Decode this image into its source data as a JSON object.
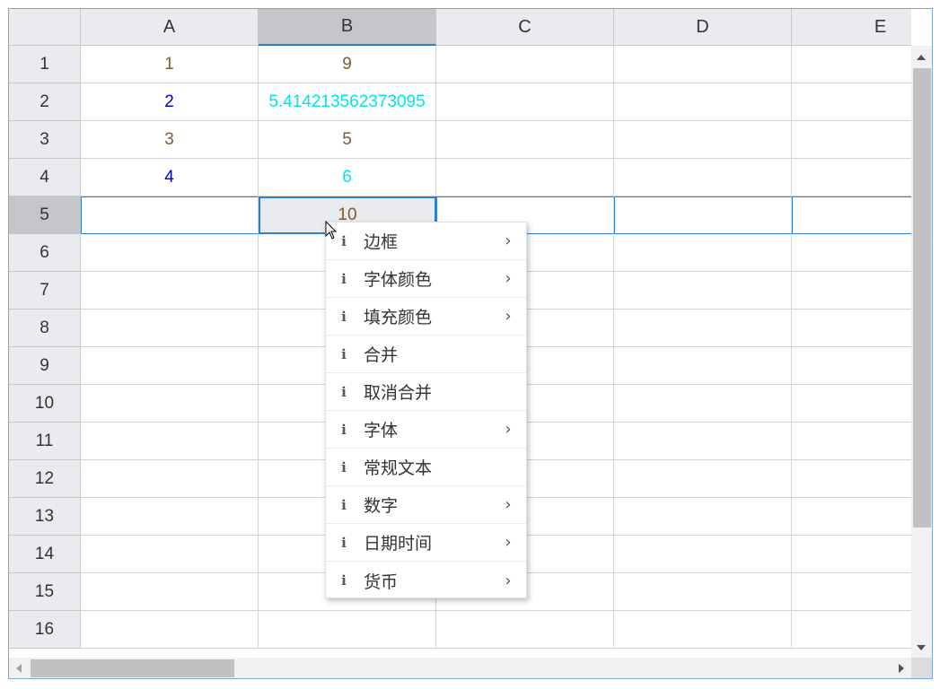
{
  "columns": [
    "A",
    "B",
    "C",
    "D",
    "E"
  ],
  "selected_column": "B",
  "rows": [
    "1",
    "2",
    "3",
    "4",
    "5",
    "6",
    "7",
    "8",
    "9",
    "10",
    "11",
    "12",
    "13",
    "14",
    "15",
    "16"
  ],
  "selected_row": "5",
  "colors": {
    "brown": "#7a5c2e",
    "blue": "#0000cc",
    "cyan": "#00e5e5",
    "selection": "#2e7fd4"
  },
  "cells": [
    {
      "ref": "A1",
      "value": "1",
      "color": "#7a5c2e"
    },
    {
      "ref": "B1",
      "value": "9",
      "color": "#7a5c2e"
    },
    {
      "ref": "A2",
      "value": "2",
      "color": "#0000cc"
    },
    {
      "ref": "B2",
      "value": "5.414213562373095",
      "color": "#00e5e5"
    },
    {
      "ref": "A3",
      "value": "3",
      "color": "#7a5c2e"
    },
    {
      "ref": "B3",
      "value": "5",
      "color": "#7a5c2e"
    },
    {
      "ref": "A4",
      "value": "4",
      "color": "#0000cc"
    },
    {
      "ref": "B4",
      "value": "6",
      "color": "#00e5e5"
    },
    {
      "ref": "B5",
      "value": "10",
      "color": "#7a5c2e"
    }
  ],
  "active_cell": "B5",
  "context_menu": {
    "items": [
      {
        "label": "边框",
        "icon": "info-icon",
        "submenu": true
      },
      {
        "label": "字体颜色",
        "icon": "info-icon",
        "submenu": true
      },
      {
        "label": "填充颜色",
        "icon": "info-icon",
        "submenu": true
      },
      {
        "label": "合并",
        "icon": "info-icon",
        "submenu": false
      },
      {
        "label": "取消合并",
        "icon": "info-icon",
        "submenu": false
      },
      {
        "label": "字体",
        "icon": "info-icon",
        "submenu": true
      },
      {
        "label": "常规文本",
        "icon": "info-icon",
        "submenu": false
      },
      {
        "label": "数字",
        "icon": "info-icon",
        "submenu": true
      },
      {
        "label": "日期时间",
        "icon": "info-icon",
        "submenu": true
      },
      {
        "label": "货币",
        "icon": "info-icon",
        "submenu": true
      }
    ]
  }
}
